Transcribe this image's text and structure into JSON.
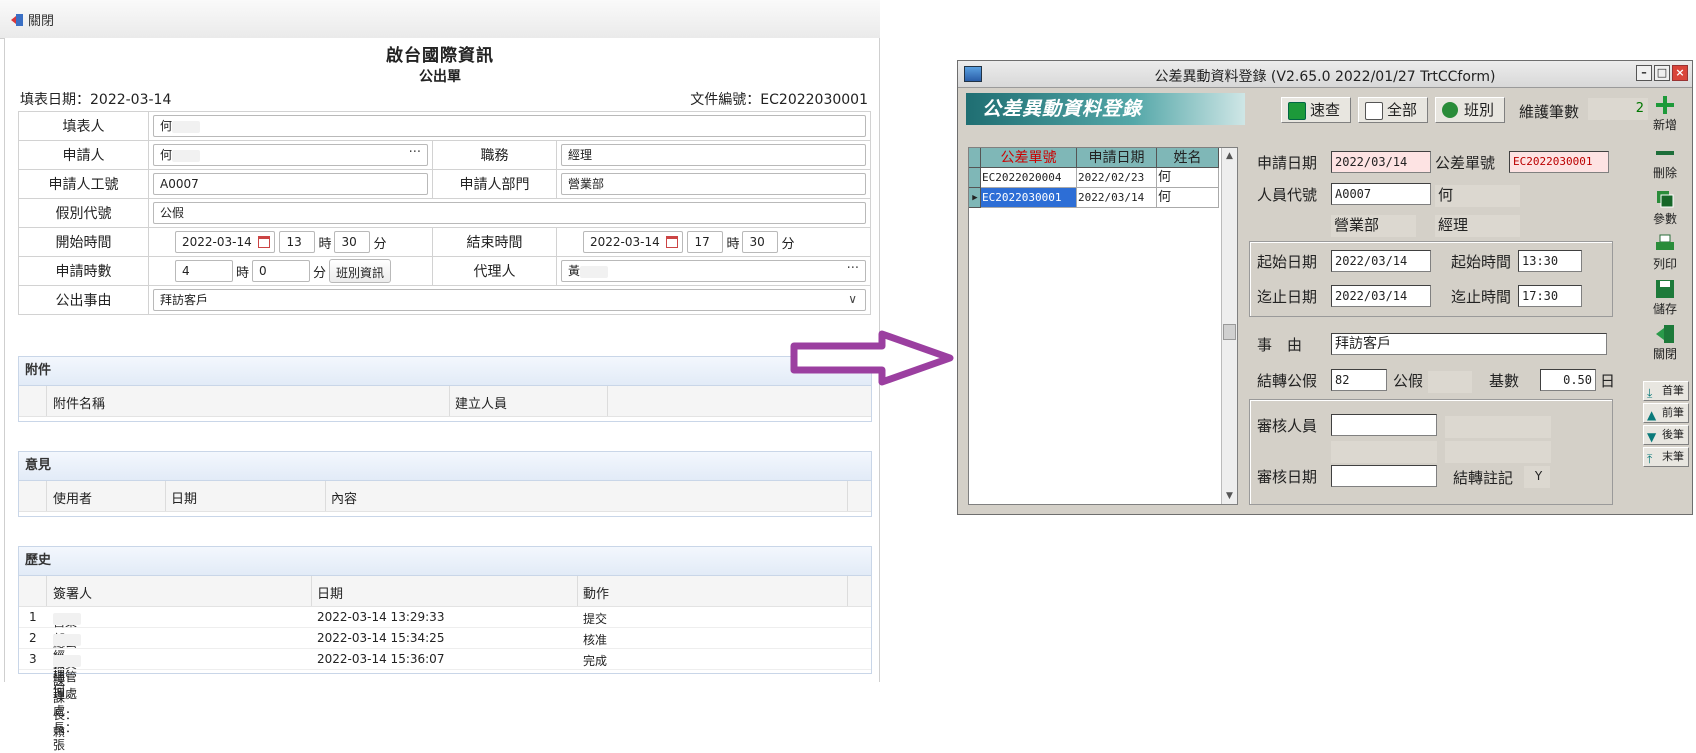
{
  "web": {
    "close_label": "關閉",
    "company": "啟台國際資訊",
    "doc_title": "公出單",
    "fill_date_label": "填表日期：2022-03-14",
    "doc_no_label": "文件編號：EC2022030001",
    "fields": {
      "filler_label": "填表人",
      "filler_value": "何",
      "applicant_label": "申請人",
      "applicant_value": "何",
      "position_label": "職務",
      "position_value": "經理",
      "emp_no_label": "申請人工號",
      "emp_no_value": "A0007",
      "dept_label": "申請人部門",
      "dept_value": "營業部",
      "leave_code_label": "假別代號",
      "leave_code_value": "公假",
      "start_label": "開始時間",
      "start_date": "2022-03-14",
      "start_hour": "13",
      "start_min": "30",
      "end_label": "結束時間",
      "end_date": "2022-03-14",
      "end_hour": "17",
      "end_min": "30",
      "hours_label": "申請時數",
      "hours_value": "4",
      "mins_value": "0",
      "shift_btn": "班別資訊",
      "agent_label": "代理人",
      "agent_value": "黃",
      "reason_label": "公出事由",
      "reason_value": "拜訪客戶",
      "unit_hour": "時",
      "unit_min": "分"
    },
    "attachments": {
      "title": "附件",
      "col_name": "附件名稱",
      "col_creator": "建立人員"
    },
    "opinions": {
      "title": "意見",
      "col_user": "使用者",
      "col_date": "日期",
      "col_content": "內容"
    },
    "history": {
      "title": "歷史",
      "col_signer": "簽署人",
      "col_date": "日期",
      "col_action": "動作",
      "rows": [
        {
          "no": "1",
          "signer": "營業部 經理：何",
          "date": "2022-03-14 13:29:33",
          "action": "提交"
        },
        {
          "no": "2",
          "signer": "總公司 總管理處處長：張",
          "date": "2022-03-14 15:34:25",
          "action": "核准"
        },
        {
          "no": "3",
          "signer": "人資課 課長：賴",
          "date": "2022-03-14 15:36:07",
          "action": "完成"
        }
      ]
    }
  },
  "app": {
    "window_title": "公差異動資料登錄 (V2.65.0 2022/01/27 TrtCCform)",
    "banner": "公差異動資料登錄",
    "btn_quick": "速查",
    "btn_all": "全部",
    "btn_shift": "班別",
    "maint_label": "維護筆數",
    "maint_count": "2",
    "grid": {
      "headers": [
        "公差單號",
        "申請日期",
        "姓名"
      ],
      "rows": [
        {
          "no": "EC2022020004",
          "date": "2022/02/23",
          "name": "何"
        },
        {
          "no": "EC2022030001",
          "date": "2022/03/14",
          "name": "何"
        }
      ]
    },
    "form": {
      "apply_date_label": "申請日期",
      "apply_date": "2022/03/14",
      "doc_no_label": "公差單號",
      "doc_no": "EC2022030001",
      "emp_code_label": "人員代號",
      "emp_code": "A0007",
      "emp_name": "何",
      "dept": "營業部",
      "title": "經理",
      "start_date_label": "起始日期",
      "start_date": "2022/03/14",
      "start_time_label": "起始時間",
      "start_time": "13:30",
      "end_date_label": "迄止日期",
      "end_date": "2022/03/14",
      "end_time_label": "迄止時間",
      "end_time": "17:30",
      "reason_label": "事　由",
      "reason": "拜訪客戶",
      "transfer_label": "結轉公假",
      "transfer_code": "82",
      "transfer_name": "公假",
      "base_label": "基數",
      "base_value": "0.50",
      "base_unit": "日",
      "reviewer_label": "審核人員",
      "review_date_label": "審核日期",
      "transfer_mark_label": "結轉註記",
      "transfer_mark": "Y"
    },
    "side": {
      "add": "新增",
      "delete": "刪除",
      "params": "參數",
      "print": "列印",
      "save": "儲存",
      "close": "關閉",
      "first": "首筆",
      "prev": "前筆",
      "next": "後筆",
      "last": "末筆"
    }
  },
  "colors": {
    "arrow": "#9b3fa0",
    "grid_header": "#7fb7b7",
    "selection": "#2d6ed6"
  }
}
